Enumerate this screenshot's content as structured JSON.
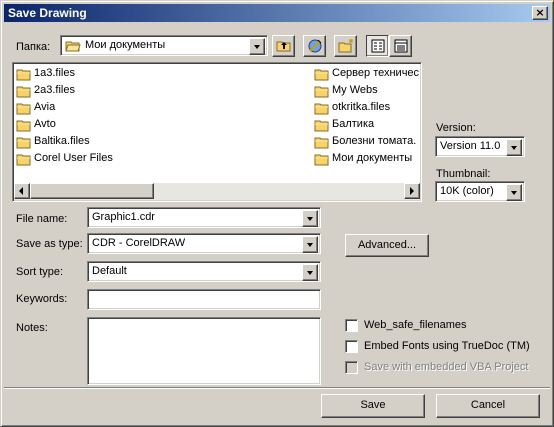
{
  "window": {
    "title": "Save Drawing",
    "close_glyph": "×"
  },
  "lookin": {
    "label": "Папка:",
    "value": "Мои документы"
  },
  "toolbar": {
    "up": "up-folder-icon",
    "web": "web-folders-icon",
    "new": "new-folder-icon",
    "list": "list-view-icon",
    "details": "details-view-icon"
  },
  "files": {
    "col1": [
      "1a3.files",
      "2a3.files",
      "Avia",
      "Avto",
      "Baltika.files",
      "Corel User Files"
    ],
    "col2": [
      "Сервер техничес",
      "My Webs",
      "otkritka.files",
      "Балтика",
      "Болезни томата.",
      "Мои документы"
    ]
  },
  "version": {
    "label": "Version:",
    "value": "Version 11.0"
  },
  "thumbnail": {
    "label": "Thumbnail:",
    "value": "10K (color)"
  },
  "filename": {
    "label": "File name:",
    "value": "Graphic1.cdr"
  },
  "saveas": {
    "label": "Save as type:",
    "value": "CDR - CorelDRAW"
  },
  "sorttype": {
    "label": "Sort type:",
    "value": "Default"
  },
  "keywords": {
    "label": "Keywords:",
    "value": ""
  },
  "notes": {
    "label": "Notes:",
    "value": ""
  },
  "advanced_label": "Advanced...",
  "options": {
    "web_safe": "Web_safe_filenames",
    "embed_fonts": "Embed Fonts using TrueDoc (TM)",
    "embed_vba": "Save with embedded VBA Project"
  },
  "buttons": {
    "save": "Save",
    "cancel": "Cancel"
  }
}
